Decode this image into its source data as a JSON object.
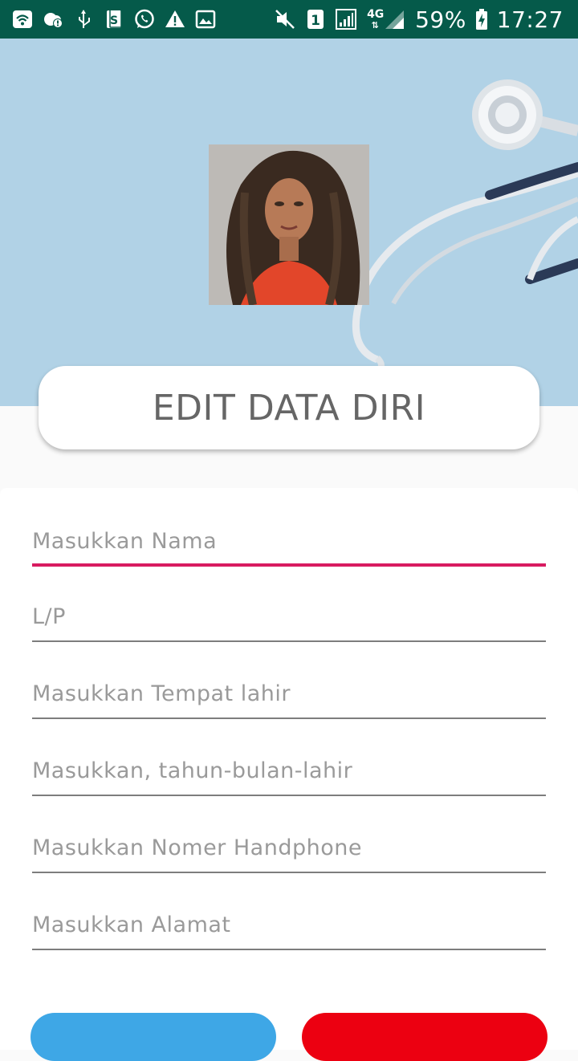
{
  "status_bar": {
    "battery_percent": "59%",
    "time": "17:27",
    "sim_slot": "1",
    "network_type": "4G",
    "left_icons": [
      "wifi-icon",
      "cloud-alert-icon",
      "usb-icon",
      "sync-app-icon",
      "whatsapp-icon",
      "warning-icon",
      "gallery-icon"
    ],
    "right_icons": [
      "vibrate-off-icon",
      "sim-1-icon",
      "signal-icon",
      "signal-4g-icon",
      "battery-charging-icon"
    ]
  },
  "header": {
    "background_color": "#b1d2e6",
    "title": "EDIT DATA DIRI"
  },
  "form": {
    "fields": [
      {
        "placeholder": "Masukkan Nama",
        "value": ""
      },
      {
        "placeholder": "L/P",
        "value": ""
      },
      {
        "placeholder": "Masukkan Tempat lahir",
        "value": ""
      },
      {
        "placeholder": "Masukkan, tahun-bulan-lahir",
        "value": ""
      },
      {
        "placeholder": "Masukkan Nomer Handphone",
        "value": ""
      },
      {
        "placeholder": "Masukkan Alamat",
        "value": ""
      }
    ],
    "active_field_color": "#d81b60"
  },
  "buttons": {
    "save_color": "#3ea7e6",
    "cancel_color": "#ec0011"
  }
}
